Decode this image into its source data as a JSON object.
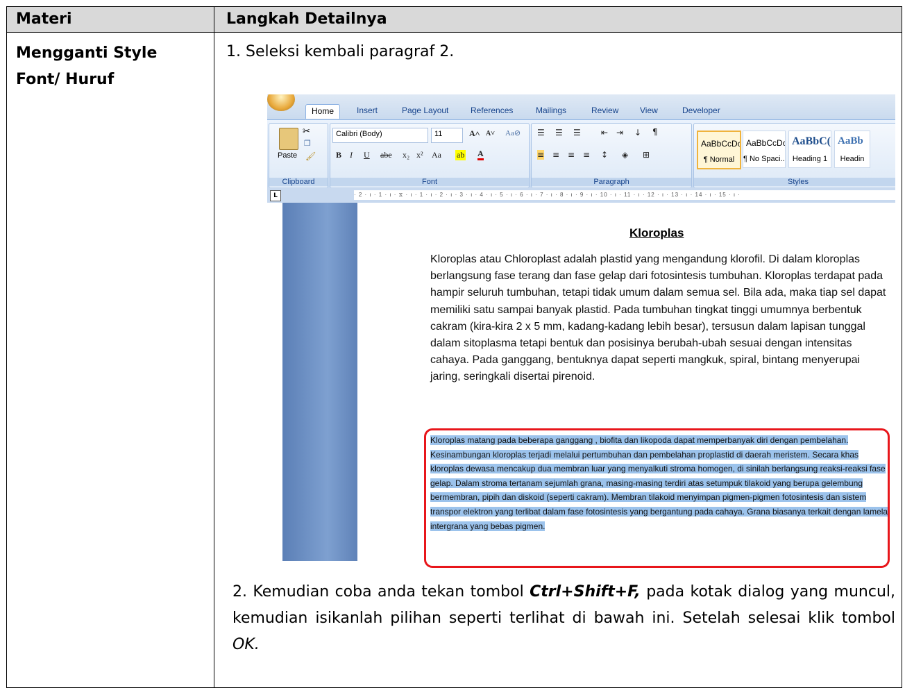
{
  "table": {
    "col1_header": "Materi",
    "col2_header": "Langkah Detailnya",
    "topic": "Mengganti Style Font/ Huruf",
    "step1": "1. Seleksi kembali paragraf 2.",
    "step2_prefix": "2. Kemudian coba anda tekan tombol ",
    "step2_key": "Ctrl+Shift+F,",
    "step2_mid": " pada kotak dialog yang muncul, kemudian isikanlah pilihan seperti terlihat di bawah ini. Setelah selesai klik tombol ",
    "step2_ok": "OK."
  },
  "word": {
    "tabs": [
      "Home",
      "Insert",
      "Page Layout",
      "References",
      "Mailings",
      "Review",
      "View",
      "Developer"
    ],
    "active_tab": "Home",
    "groups": {
      "clipboard": "Clipboard",
      "font": "Font",
      "paragraph": "Paragraph",
      "styles": "Styles"
    },
    "paste_label": "Paste",
    "font_name": "Calibri (Body)",
    "font_size": "11",
    "styles": [
      {
        "sample": "AaBbCcDc",
        "name": "¶ Normal"
      },
      {
        "sample": "AaBbCcDc",
        "name": "¶ No Spaci..."
      },
      {
        "sample": "AaBbC(",
        "name": "Heading 1"
      },
      {
        "sample": "AaBb",
        "name": "Headin"
      }
    ],
    "ruler_text": "· 2 · ı · 1 · ı · ⧖ · ı · 1 · ı · 2 · ı · 3 · ı · 4 · ı · 5 · ı · 6 · ı · 7 · ı · 8 · ı · 9 · ı · 10 · ı · 11 · ı · 12 · ı · 13 · ı · 14 · ı · 15 · ı ·",
    "doc_title": "Kloroplas",
    "paragraph1": "Kloroplas atau Chloroplast adalah plastid yang mengandung klorofil. Di dalam kloroplas berlangsung fase terang dan fase gelap dari fotosintesis tumbuhan. Kloroplas terdapat pada hampir seluruh tumbuhan, tetapi tidak umum dalam semua sel. Bila ada, maka tiap sel dapat memiliki satu sampai banyak plastid. Pada tumbuhan tingkat tinggi umumnya berbentuk cakram (kira-kira 2 x 5 mm, kadang-kadang lebih besar), tersusun dalam lapisan tunggal dalam sitoplasma tetapi bentuk dan posisinya berubah-ubah sesuai dengan intensitas cahaya. Pada ganggang, bentuknya dapat seperti mangkuk, spiral, bintang menyerupai jaring, seringkali disertai pirenoid.",
    "paragraph2": "Kloroplas matang pada beberapa ganggang , biofita dan likopoda dapat memperbanyak diri dengan pembelahan. Kesinambungan kloroplas terjadi melalui pertumbuhan dan pembelahan proplastid di daerah meristem. Secara khas kloroplas dewasa mencakup dua membran luar yang menyalkuti stroma homogen, di sinilah berlangsung reaksi-reaksi fase gelap. Dalam stroma tertanam sejumlah grana, masing-masing terdiri atas setumpuk tilakoid yang berupa gelembung bermembran, pipih dan diskoid (seperti cakram). Membran tilakoid menyimpan pigmen-pigmen fotosintesis dan sistem transpor elektron yang terlibat dalam fase fotosintesis yang bergantung pada cahaya. Grana biasanya terkait dengan lamela intergrana yang bebas pigmen.",
    "colors": {
      "selection": "#9cc3ec",
      "annotation": "#e8161b"
    }
  }
}
